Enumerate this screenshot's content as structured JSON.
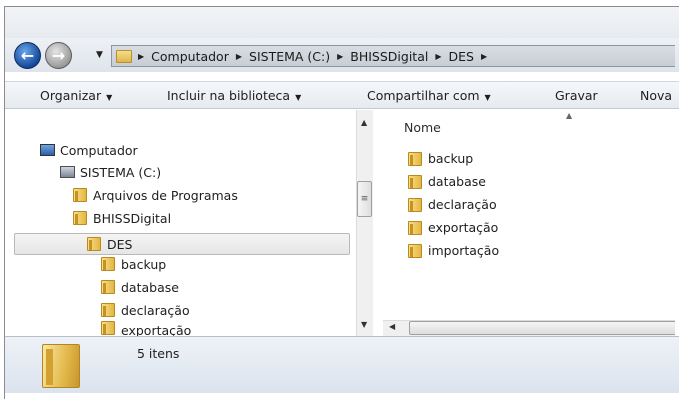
{
  "address": {
    "crumbs": [
      "Computador",
      "SISTEMA (C:)",
      "BHISSDigital",
      "DES"
    ]
  },
  "toolbar": {
    "organize": "Organizar",
    "include_library": "Incluir na biblioteca",
    "share": "Compartilhar com",
    "burn": "Gravar",
    "new_folder": "Nova"
  },
  "tree": {
    "computer": "Computador",
    "drive": "SISTEMA (C:)",
    "items": [
      "Arquivos de Programas",
      "BHISSDigital",
      "DES",
      "backup",
      "database",
      "declaração",
      "exportação"
    ]
  },
  "content": {
    "column_name": "Nome",
    "items": [
      "backup",
      "database",
      "declaração",
      "exportação",
      "importação"
    ]
  },
  "status": {
    "count_text": "5 itens"
  },
  "colors": {
    "folder": "#e4b640",
    "nav_back": "#14489a",
    "selection": "#e6e6e6"
  },
  "icons": [
    "back-arrow-icon",
    "forward-arrow-icon",
    "folder-icon",
    "computer-icon",
    "drive-icon"
  ]
}
